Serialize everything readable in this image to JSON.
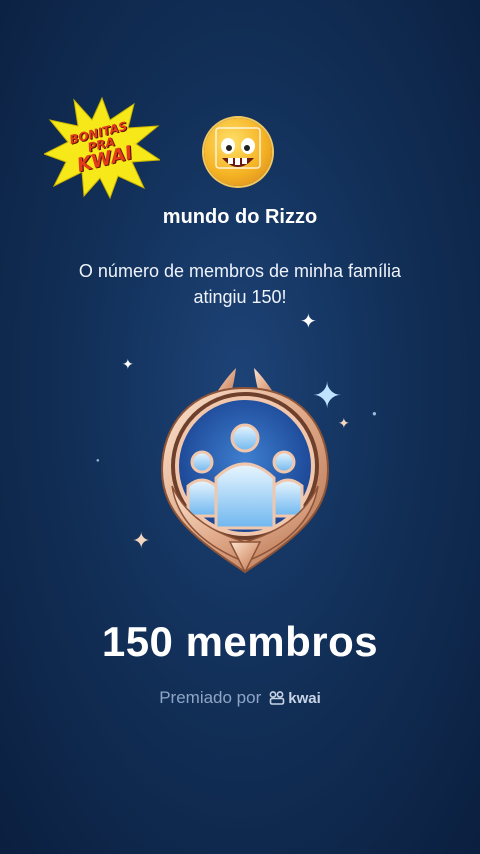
{
  "sticker": {
    "line1": "BONITAS",
    "line2": "PRA",
    "line3": "KWAI"
  },
  "user": {
    "name": "mundo do Rizzo"
  },
  "message": "O número de membros de minha família atingiu 150!",
  "achievement": {
    "count_label": "150 membros"
  },
  "awarded": {
    "prefix": "Premiado por",
    "brand": "kwai"
  },
  "icons": {
    "badge": "family-badge-icon",
    "avatar": "emoji-avatar-icon",
    "logo": "kwai-logo-icon"
  },
  "colors": {
    "background": "#123059",
    "title": "#ffffff",
    "muted": "#8fa5c6",
    "sticker_star": "#f7e81a",
    "sticker_text": "#e23b1c"
  }
}
